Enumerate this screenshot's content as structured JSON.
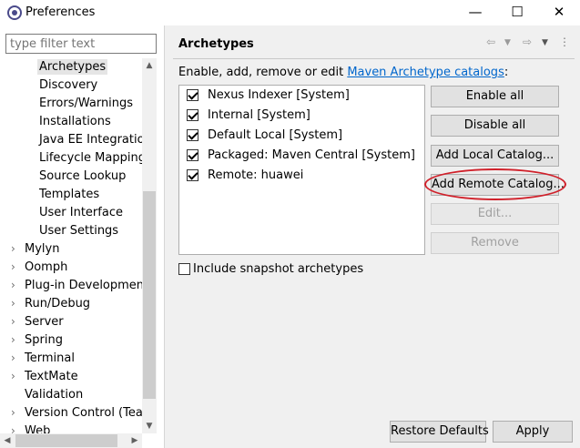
{
  "window": {
    "title": "Preferences",
    "minimize": "—",
    "maximize": "☐",
    "close": "✕"
  },
  "filter": {
    "placeholder": "type filter text"
  },
  "tree": {
    "items": [
      {
        "label": "Archetypes",
        "selected": true
      },
      {
        "label": "Discovery"
      },
      {
        "label": "Errors/Warnings"
      },
      {
        "label": "Installations"
      },
      {
        "label": "Java EE Integration"
      },
      {
        "label": "Lifecycle Mappings"
      },
      {
        "label": "Source Lookup"
      },
      {
        "label": "Templates"
      },
      {
        "label": "User Interface"
      },
      {
        "label": "User Settings"
      },
      {
        "label": "Mylyn",
        "expandable": true
      },
      {
        "label": "Oomph",
        "expandable": true
      },
      {
        "label": "Plug-in Development",
        "expandable": true
      },
      {
        "label": "Run/Debug",
        "expandable": true
      },
      {
        "label": "Server",
        "expandable": true
      },
      {
        "label": "Spring",
        "expandable": true
      },
      {
        "label": "Terminal",
        "expandable": true
      },
      {
        "label": "TextMate",
        "expandable": true
      },
      {
        "label": "Validation"
      },
      {
        "label": "Version Control (Team)",
        "expandable": true
      },
      {
        "label": "Web",
        "expandable": true
      }
    ]
  },
  "page": {
    "title": "Archetypes",
    "description": "Enable, add, remove or edit",
    "description_link": "Maven Archetype catalogs",
    "description_suffix": ":"
  },
  "catalogs": [
    {
      "label": "Nexus Indexer [System]",
      "checked": true
    },
    {
      "label": "Internal [System]",
      "checked": true
    },
    {
      "label": "Default Local [System]",
      "checked": true
    },
    {
      "label": "Packaged: Maven Central [System]",
      "checked": true
    },
    {
      "label": "Remote: huawei",
      "checked": true
    }
  ],
  "buttons": {
    "enable_all": "Enable all",
    "disable_all": "Disable all",
    "add_local": "Add Local Catalog...",
    "add_remote": "Add Remote Catalog...",
    "edit": "Edit...",
    "remove": "Remove"
  },
  "snapshot": {
    "label": "Include snapshot archetypes",
    "checked": false
  },
  "footer": {
    "restore_defaults": "Restore Defaults",
    "apply": "Apply"
  },
  "colors": {
    "highlight_ellipse": "#d0202a",
    "link": "#0066cc"
  }
}
